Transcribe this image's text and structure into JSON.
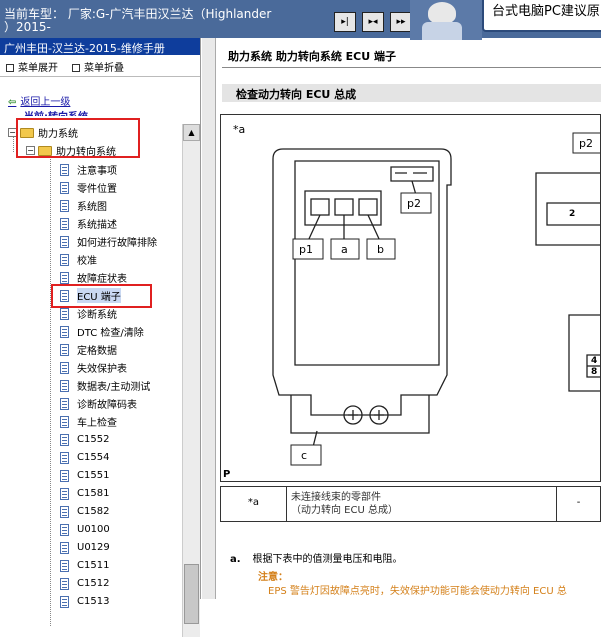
{
  "header": {
    "title_line1": "当前车型：  厂家:G-广汽丰田汉兰达（Highlander",
    "title_line2": "）2015-",
    "promo_text": "台式电脑PC建议原",
    "nav_buttons": [
      "▸|",
      "▸◂",
      "▸▸"
    ]
  },
  "sidebar": {
    "manual_title": "广州丰田-汉兰达-2015-维修手册",
    "expand_label": "菜单展开",
    "collapse_label": "菜单折叠",
    "back_label": "返回上一级",
    "current_label": "当前:转向系统",
    "tree_root": "助力系统",
    "tree_sub": "助力转向系统",
    "items": [
      "注意事项",
      "零件位置",
      "系统图",
      "系统描述",
      "如何进行故障排除",
      "校准",
      "故障症状表",
      "ECU 端子",
      "诊断系统",
      "DTC 检查/清除",
      "定格数据",
      "失效保护表",
      "数据表/主动测试",
      "诊断故障码表",
      "车上检查",
      "C1552",
      "C1554",
      "C1551",
      "C1581",
      "C1582",
      "U0100",
      "U0129",
      "C1511",
      "C1512",
      "C1513"
    ],
    "selected_index": 7
  },
  "main": {
    "breadcrumb": "助力系统  助力转向系统  ECU 端子",
    "section_title": "检查动力转向 ECU 总成",
    "diagram": {
      "star_label": "*a",
      "labels": [
        "p1",
        "a",
        "b",
        "p2",
        "c"
      ],
      "right_label_p2": "p2",
      "pin_2": "2",
      "pin_4": "4",
      "pin_8": "8",
      "corner": "P"
    },
    "legend": {
      "key": "*a",
      "value_line1": "未连接线束的零部件",
      "value_line2": "（动力转向 ECU 总成）",
      "right": "-"
    },
    "step_marker": "a.",
    "step_text": "根据下表中的值测量电压和电阻。",
    "note_heading": "注意：",
    "note_text": "EPS 警告灯因故障点亮时，失效保护功能可能会使动力转向 ECU 总"
  }
}
